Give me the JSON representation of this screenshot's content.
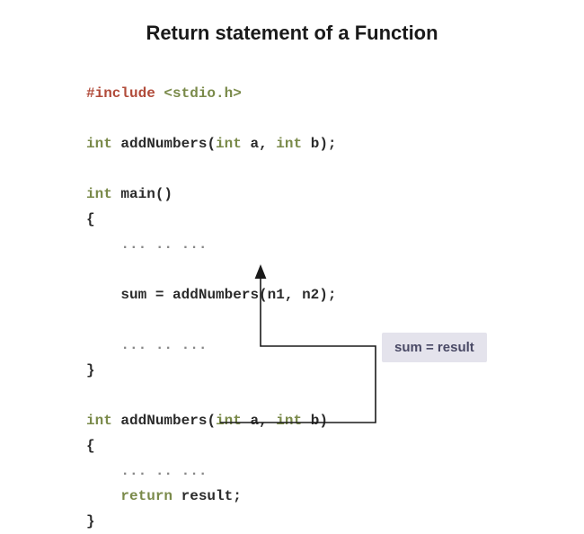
{
  "title": "Return statement of a Function",
  "code": {
    "include_kw": "#include",
    "include_hdr": "<stdio.h>",
    "proto_type": "int",
    "proto_name": "addNumbers",
    "proto_p1_type": "int",
    "proto_p1_name": "a",
    "proto_p2_type": "int",
    "proto_p2_name": "b",
    "main_type": "int",
    "main_name": "main",
    "ellipsis": "... .. ...",
    "call_lhs": "sum",
    "call_eq": " = ",
    "call_fn": "addNumbers",
    "call_arg1": "n1",
    "call_arg2": "n2",
    "def_type": "int",
    "def_name": "addNumbers",
    "def_p1_type": "int",
    "def_p1_name": "a",
    "def_p2_type": "int",
    "def_p2_name": "b",
    "return_kw": "return",
    "return_val": "result"
  },
  "annotation": "sum = result"
}
